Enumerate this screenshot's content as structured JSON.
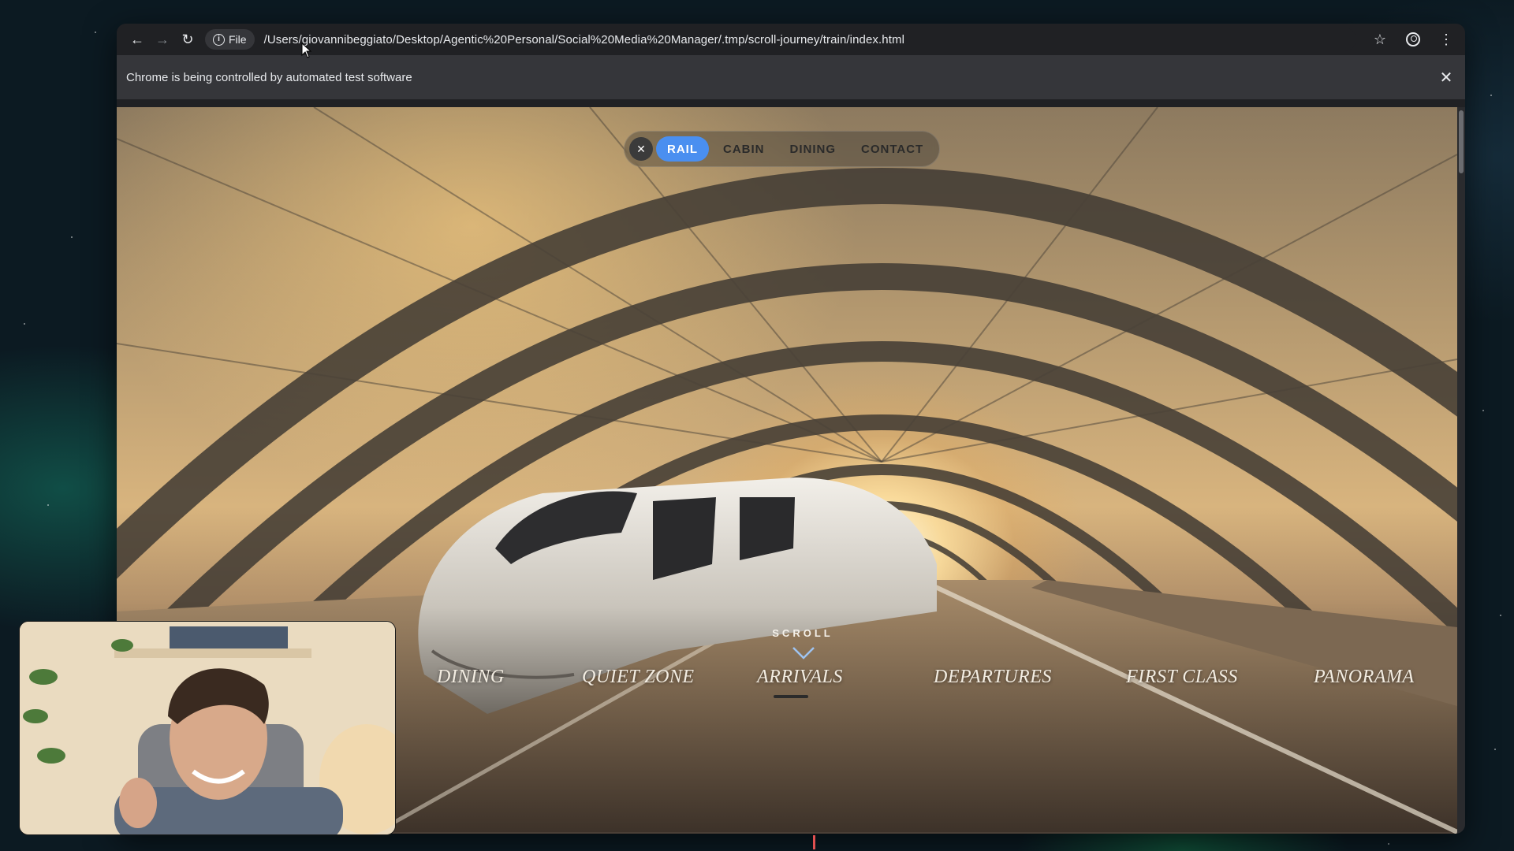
{
  "browser": {
    "scheme_chip": "File",
    "url": "/Users/giovannibeggiato/Desktop/Agentic%20Personal/Social%20Media%20Manager/.tmp/scroll-journey/train/index.html",
    "icons": {
      "back": "arrow-left",
      "forward": "arrow-right",
      "reload": "reload",
      "info": "info",
      "bookmark": "star",
      "profile": "account",
      "menu": "kebab"
    }
  },
  "infobar": {
    "message": "Chrome is being controlled by automated test software"
  },
  "page": {
    "top_nav": {
      "items": [
        "RAIL",
        "CABIN",
        "DINING",
        "CONTACT"
      ],
      "active": "RAIL",
      "accent_color": "#4a8ff0"
    },
    "scroll_hint": "SCROLL",
    "bottom_menu": {
      "items": [
        "DINING",
        "QUIET ZONE",
        "ARRIVALS",
        "DEPARTURES",
        "FIRST CLASS",
        "PANORAMA"
      ],
      "active": "ARRIVALS"
    }
  }
}
